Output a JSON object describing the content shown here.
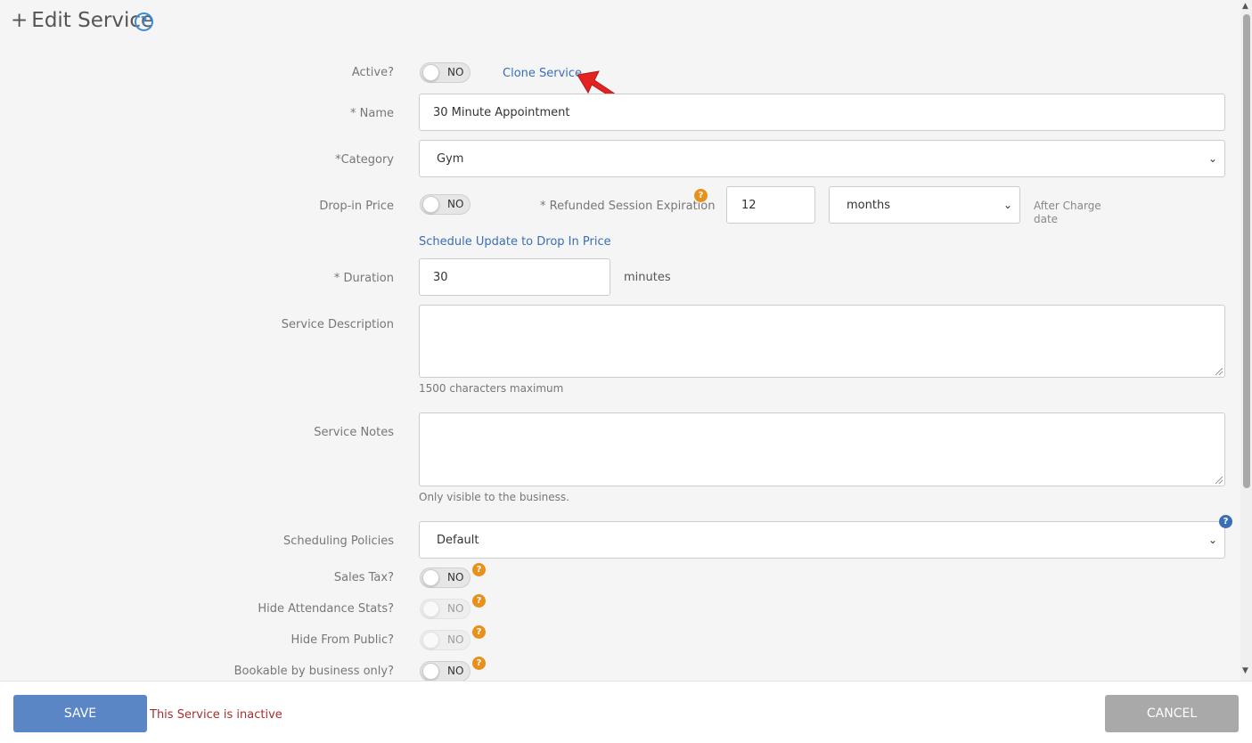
{
  "header": {
    "plus": "+",
    "title": "Edit Service",
    "help_glyph": "?"
  },
  "active": {
    "label": "Active?",
    "toggle": "NO",
    "clone_link": "Clone Service"
  },
  "name": {
    "label": "* Name",
    "value": "30 Minute Appointment"
  },
  "category": {
    "label": "*Category",
    "value": "Gym"
  },
  "dropin": {
    "label": "Drop-in Price",
    "toggle": "NO",
    "refund_label": "* Refunded Session Expiration",
    "refund_value": "12",
    "refund_unit": "months",
    "after_line1": "After Charge",
    "after_line2": "date",
    "schedule_link": "Schedule Update to Drop In Price"
  },
  "duration": {
    "label": "* Duration",
    "value": "30",
    "unit": "minutes"
  },
  "description": {
    "label": "Service Description",
    "hint": "1500 characters maximum"
  },
  "notes": {
    "label": "Service Notes",
    "hint": "Only visible to the business."
  },
  "scheduling": {
    "label": "Scheduling Policies",
    "value": "Default"
  },
  "sales_tax": {
    "label": "Sales Tax?",
    "toggle": "NO"
  },
  "hide_attendance": {
    "label": "Hide Attendance Stats?",
    "toggle": "NO"
  },
  "hide_public": {
    "label": "Hide From Public?",
    "toggle": "NO"
  },
  "bookable": {
    "label": "Bookable by business only?",
    "toggle": "NO"
  },
  "footer": {
    "save": "SAVE",
    "status": "This Service is inactive",
    "cancel": "CANCEL"
  },
  "colors": {
    "save": "#5b86c6",
    "cancel": "#a9a9a9",
    "link": "#3a6fb5",
    "badge": "#e8901c",
    "status": "#a23030"
  },
  "icons": {
    "help": "question-circle-icon",
    "caret": "chevron-down-icon",
    "badge": "question-badge-icon"
  }
}
